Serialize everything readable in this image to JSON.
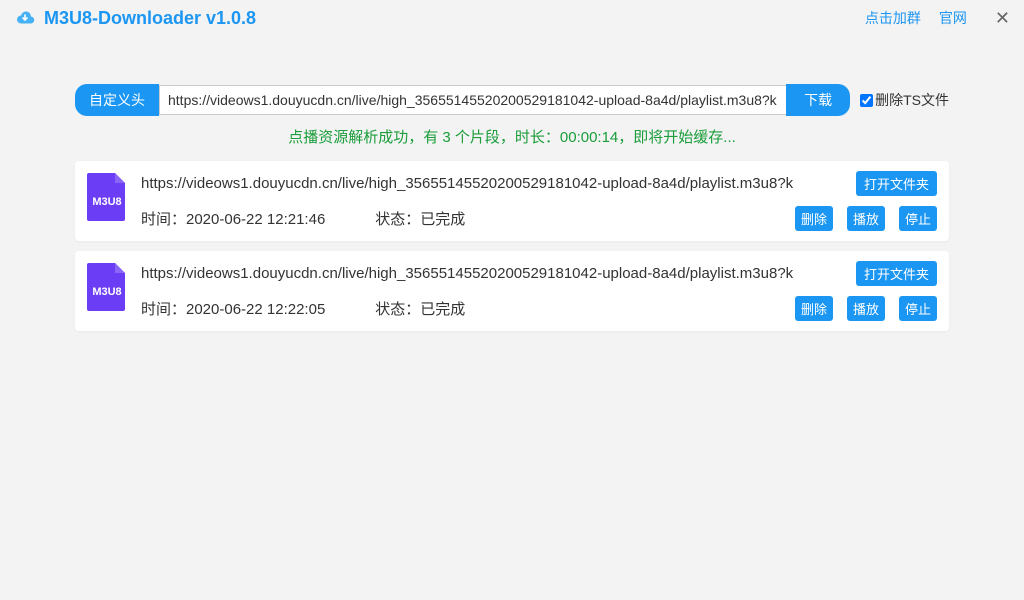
{
  "titlebar": {
    "title": "M3U8-Downloader v1.0.8",
    "link_group": "点击加群",
    "link_site": "官网"
  },
  "toolbar": {
    "custom_header": "自定义头",
    "url_value": "https://videows1.douyucdn.cn/live/high_3565514552020052918​1042-upload-8a4d/playlist.m3u8?k",
    "download": "下载",
    "delete_ts": "删除TS文件",
    "delete_ts_checked": true
  },
  "status_message": "点播资源解析成功，有 3 个片段，时长：00:00:14，即将开始缓存...",
  "labels": {
    "time_prefix": "时间：",
    "status_prefix": "状态：",
    "open_folder": "打开文件夹",
    "delete": "删除",
    "play": "播放",
    "stop": "停止"
  },
  "file_icon_label": "M3U8",
  "downloads": [
    {
      "url": "https://videows1.douyucdn.cn/live/high_3565514552020052918​1042-upload-8a4d/playlist.m3u8?k",
      "time": "2020-06-22 12:21:46",
      "status": "已完成"
    },
    {
      "url": "https://videows1.douyucdn.cn/live/high_3565514552020052918​1042-upload-8a4d/playlist.m3u8?k",
      "time": "2020-06-22 12:22:05",
      "status": "已完成"
    }
  ]
}
